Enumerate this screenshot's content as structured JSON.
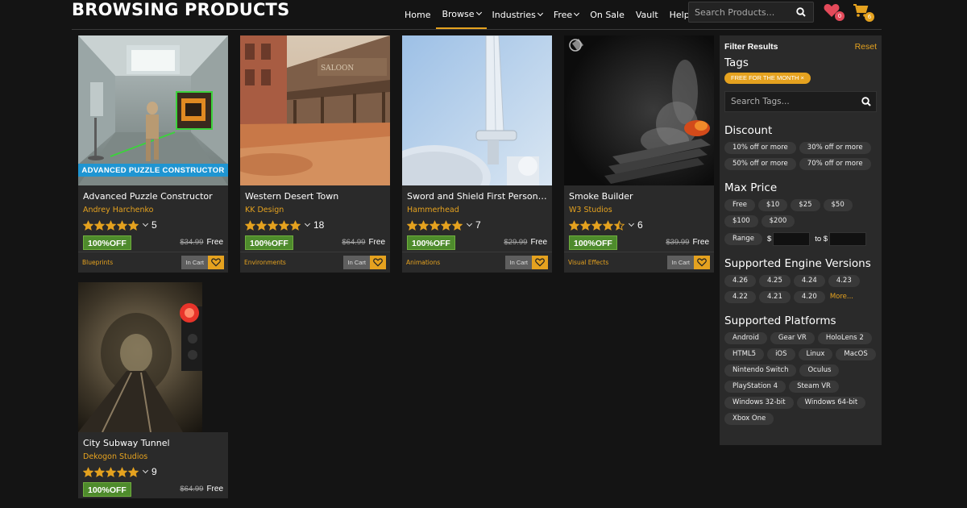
{
  "header": {
    "title": "BROWSING PRODUCTS",
    "nav": [
      {
        "label": "Home",
        "dropdown": false,
        "active": false
      },
      {
        "label": "Browse",
        "dropdown": true,
        "active": true
      },
      {
        "label": "Industries",
        "dropdown": true,
        "active": false
      },
      {
        "label": "Free",
        "dropdown": true,
        "active": false
      },
      {
        "label": "On Sale",
        "dropdown": false,
        "active": false
      },
      {
        "label": "Vault",
        "dropdown": false,
        "active": false
      },
      {
        "label": "Help",
        "dropdown": false,
        "active": false
      }
    ],
    "search_placeholder": "Search Products...",
    "wishlist_count": "0",
    "cart_count": "6"
  },
  "colors": {
    "accent": "#e5a21f",
    "discount_green": "#4e8b2c",
    "ribbon_blue": "#1f95d2",
    "wishlist_badge": "#e34a5a"
  },
  "products": [
    {
      "name": "Advanced Puzzle Constructor",
      "author": "Andrey Harchenko",
      "rating": 5,
      "rating_count": "5",
      "discount": "100%OFF",
      "old_price": "$34.99",
      "price": "Free",
      "category": "Blueprints",
      "cart_label": "In Cart",
      "ribbon": "ADVANCED PUZZLE CONSTRUCTOR"
    },
    {
      "name": "Western Desert Town",
      "author": "KK Design",
      "rating": 5,
      "rating_count": "18",
      "discount": "100%OFF",
      "old_price": "$64.99",
      "price": "Free",
      "category": "Environments",
      "cart_label": "In Cart",
      "ribbon": ""
    },
    {
      "name": "Sword and Shield First Person An...",
      "author": "Hammerhead",
      "rating": 5,
      "rating_count": "7",
      "discount": "100%OFF",
      "old_price": "$29.99",
      "price": "Free",
      "category": "Animations",
      "cart_label": "In Cart",
      "ribbon": ""
    },
    {
      "name": "Smoke Builder",
      "author": "W3 Studios",
      "rating": 4.5,
      "rating_count": "6",
      "discount": "100%OFF",
      "old_price": "$39.99",
      "price": "Free",
      "category": "Visual Effects",
      "cart_label": "In Cart",
      "ribbon": ""
    },
    {
      "name": "City Subway Tunnel",
      "author": "Dekogon Studios",
      "rating": 5,
      "rating_count": "9",
      "discount": "100%OFF",
      "old_price": "$64.99",
      "price": "Free",
      "category": "",
      "cart_label": "",
      "ribbon": ""
    }
  ],
  "sidebar": {
    "title": "Filter Results",
    "reset": "Reset",
    "tags_heading": "Tags",
    "active_tag": "FREE FOR THE MONTH ×",
    "tag_search_placeholder": "Search Tags...",
    "discount_heading": "Discount",
    "discounts": [
      "10% off or more",
      "30% off or more",
      "50% off or more",
      "70% off or more"
    ],
    "max_price_heading": "Max Price",
    "prices": [
      "Free",
      "$10",
      "$25",
      "$50",
      "$100",
      "$200"
    ],
    "range_label": "Range",
    "range_from_symbol": "$",
    "range_to_label": "to $",
    "engine_heading": "Supported Engine Versions",
    "engines": [
      "4.26",
      "4.25",
      "4.24",
      "4.23",
      "4.22",
      "4.21",
      "4.20"
    ],
    "engines_more": "More...",
    "platforms_heading": "Supported Platforms",
    "platforms": [
      "Android",
      "Gear VR",
      "HoloLens 2",
      "HTML5",
      "iOS",
      "Linux",
      "MacOS",
      "Nintendo Switch",
      "Oculus",
      "PlayStation 4",
      "Steam VR",
      "Windows 32-bit",
      "Windows 64-bit",
      "Xbox One"
    ]
  }
}
